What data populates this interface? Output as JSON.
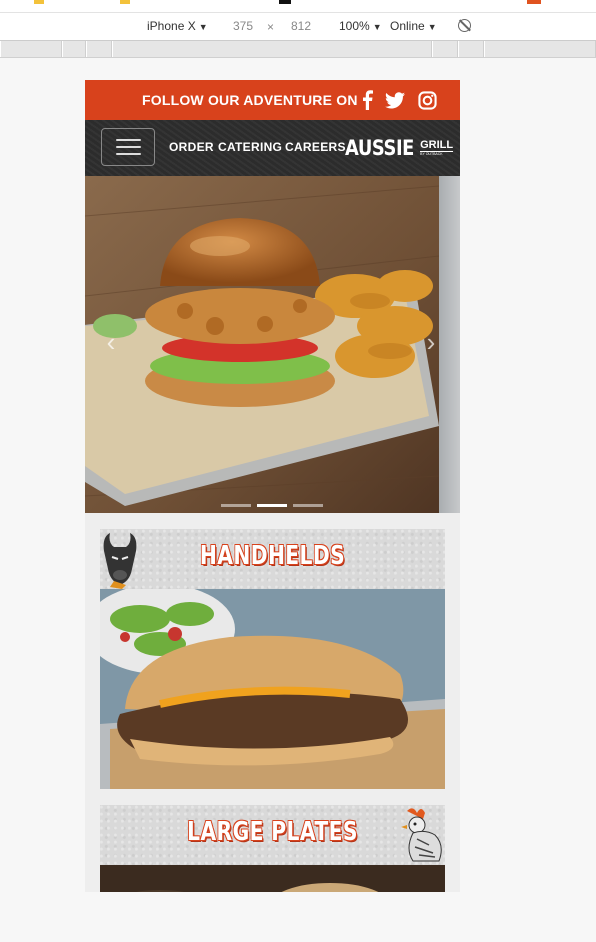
{
  "devtools": {
    "device": "iPhone X",
    "width": "375",
    "times": "×",
    "height": "812",
    "zoom": "100%",
    "network": "Online",
    "rotate_icon": "rotate-icon"
  },
  "site": {
    "follow_text": "FOLLOW OUR ADVENTURE ON",
    "social_icons": [
      "facebook-icon",
      "twitter-icon",
      "instagram-icon"
    ],
    "nav_links": [
      "ORDER",
      "CATERING",
      "CAREERS"
    ],
    "logo_main": "AUSSIE",
    "logo_side": "GRILL",
    "logo_sub": "BY OUTBACK",
    "carousel": {
      "prev_icon": "‹",
      "next_icon": "›",
      "slide_count": 3,
      "active_index": 1
    },
    "sections": [
      {
        "title": "HANDHELDS",
        "mascot": "bull-mascot"
      },
      {
        "title": "LARGE PLATES",
        "mascot": "rooster-mascot"
      }
    ]
  },
  "colors": {
    "brand_orange": "#d8421c",
    "nav_dark": "#2e2e2e"
  }
}
